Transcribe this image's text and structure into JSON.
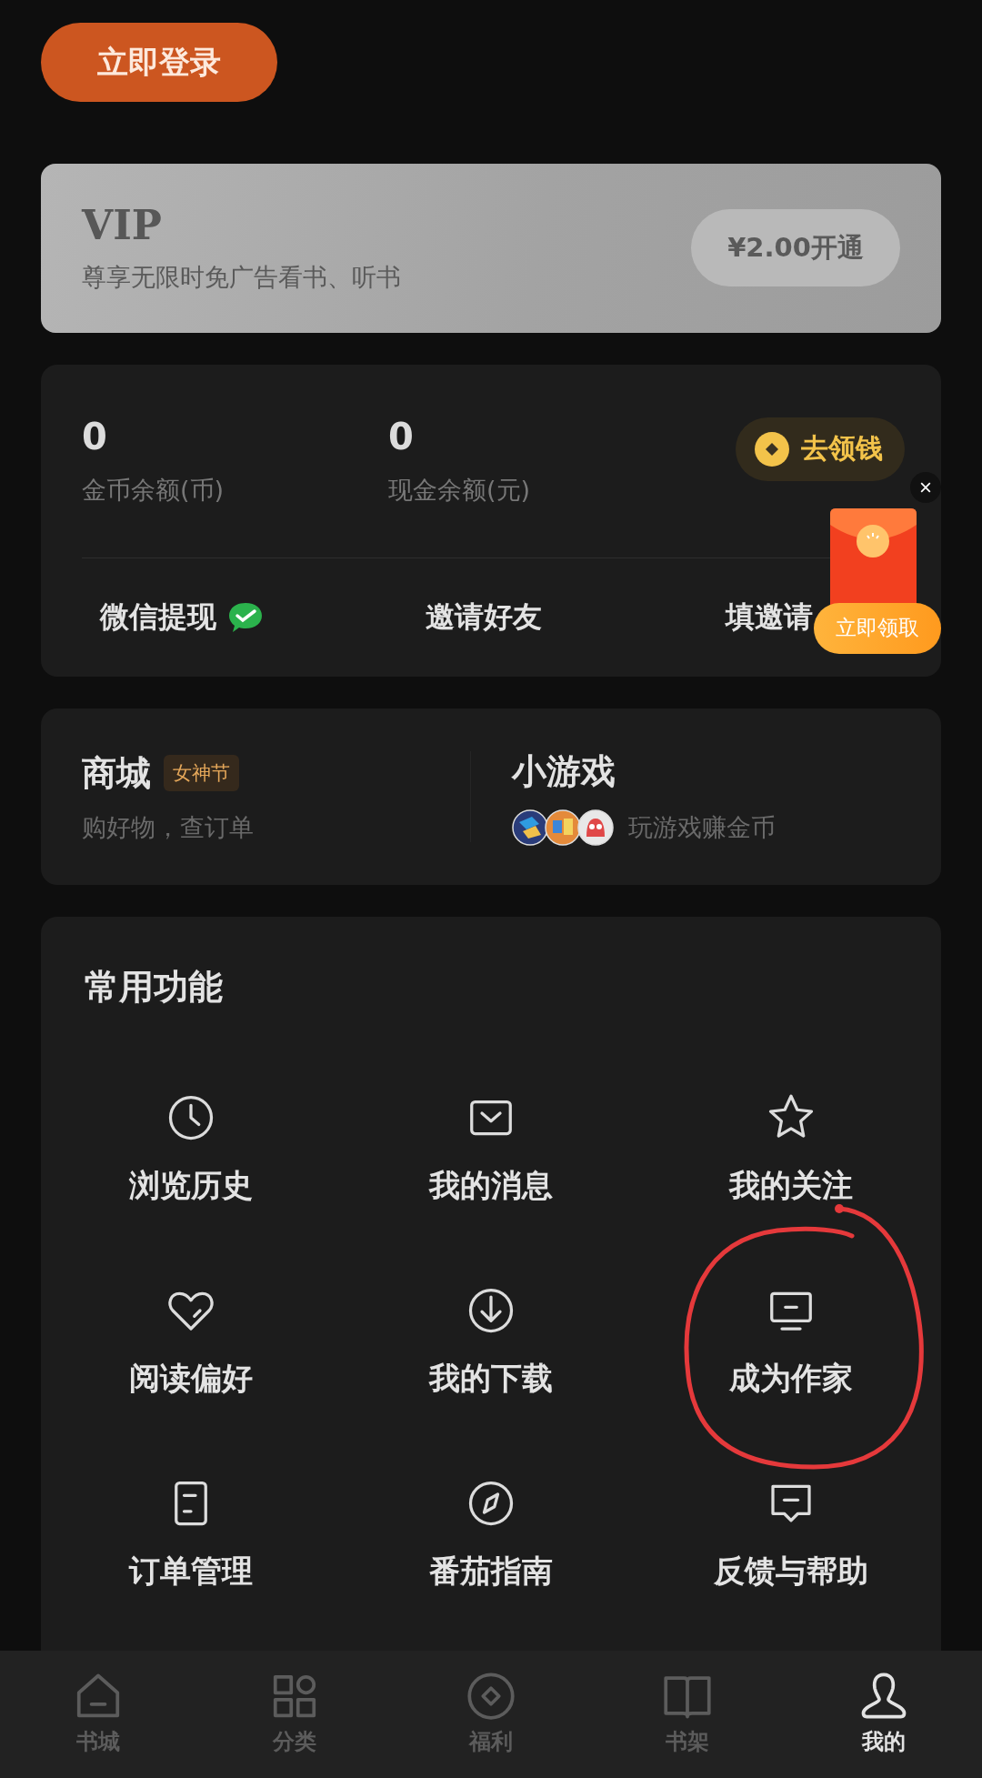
{
  "login_button": "立即登录",
  "vip": {
    "title": "VIP",
    "subtitle": "尊享无限时免广告看书、听书",
    "button": "¥2.00开通"
  },
  "wallet": {
    "balances": [
      {
        "value": "0",
        "label": "金币余额(币)"
      },
      {
        "value": "0",
        "label": "现金余额(元)"
      }
    ],
    "claim_button": "去领钱",
    "actions": [
      {
        "label": "微信提现",
        "kind": "wechat"
      },
      {
        "label": "邀请好友",
        "kind": "plain"
      },
      {
        "label": "填邀请",
        "kind": "plain"
      }
    ]
  },
  "popup": {
    "button": "立即领取"
  },
  "mall": {
    "title": "商城",
    "tag": "女神节",
    "subtitle": "购好物，查订单"
  },
  "games": {
    "title": "小游戏",
    "subtitle": "玩游戏赚金币"
  },
  "functions": {
    "title": "常用功能",
    "items": [
      {
        "label": "浏览历史",
        "kind": "clock",
        "circled": false
      },
      {
        "label": "我的消息",
        "kind": "message",
        "circled": false
      },
      {
        "label": "我的关注",
        "kind": "star",
        "circled": false
      },
      {
        "label": "阅读偏好",
        "kind": "heart",
        "circled": false
      },
      {
        "label": "我的下载",
        "kind": "download",
        "circled": false
      },
      {
        "label": "成为作家",
        "kind": "monitor",
        "circled": true
      },
      {
        "label": "订单管理",
        "kind": "order",
        "circled": false
      },
      {
        "label": "番茄指南",
        "kind": "compass",
        "circled": false
      },
      {
        "label": "反馈与帮助",
        "kind": "feedback",
        "circled": false
      }
    ]
  },
  "tabs": [
    {
      "label": "书城",
      "kind": "home",
      "selected": false
    },
    {
      "label": "分类",
      "kind": "grid",
      "selected": false
    },
    {
      "label": "福利",
      "kind": "coin",
      "selected": false
    },
    {
      "label": "书架",
      "kind": "book",
      "selected": false
    },
    {
      "label": "我的",
      "kind": "person",
      "selected": true
    }
  ]
}
